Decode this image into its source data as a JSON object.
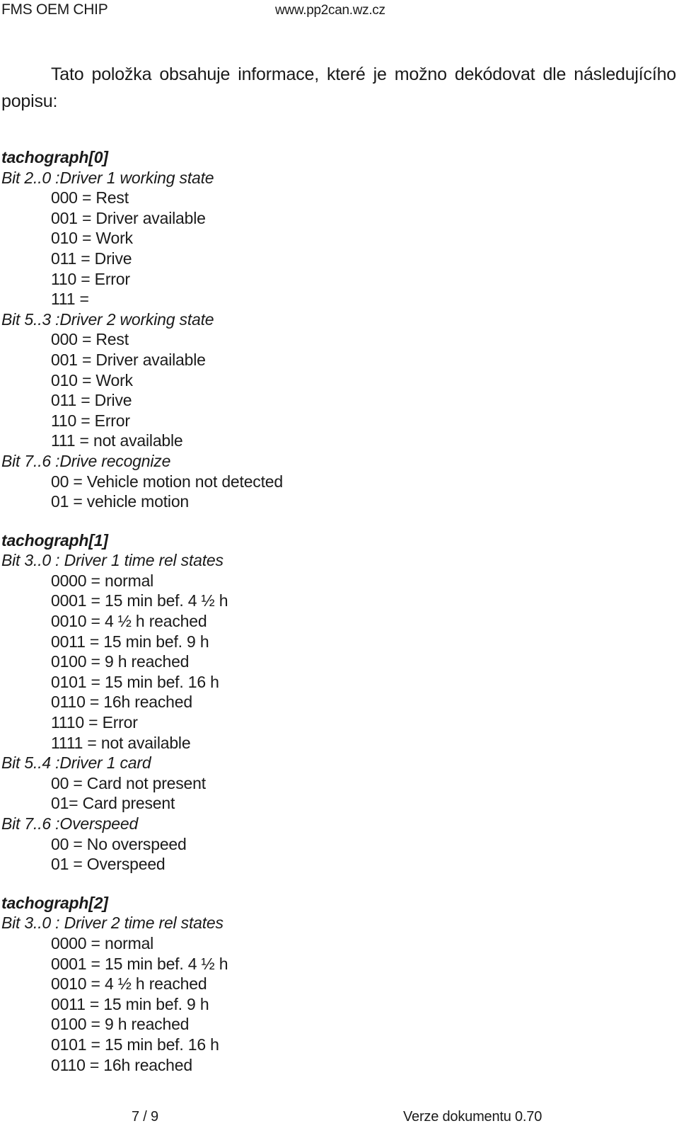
{
  "header": {
    "left": "FMS OEM CHIP",
    "right": "www.pp2can.wz.cz"
  },
  "intro": "Tato položka obsahuje informace, které je možno dekódovat dle následujícího popisu:",
  "sections": [
    {
      "title": "tachograph[0]",
      "groups": [
        {
          "bit": "Bit  2..0 :Driver 1 working state",
          "values": [
            "000 = Rest",
            "001 = Driver available",
            "010 = Work",
            "011 = Drive",
            "110 = Error",
            "111 = "
          ]
        },
        {
          "bit": "Bit  5..3 :Driver 2 working state",
          "values": [
            "000 = Rest",
            "001 = Driver available",
            "010 = Work",
            "011 = Drive",
            "110 = Error",
            "111 = not available"
          ]
        },
        {
          "bit": "Bit  7..6 :Drive recognize",
          "values": [
            "00 = Vehicle motion not detected",
            "01 = vehicle motion"
          ]
        }
      ]
    },
    {
      "title": "tachograph[1]",
      "groups": [
        {
          "bit": "Bit  3..0 : Driver 1 time rel states",
          "values": [
            "0000 = normal",
            "0001 = 15 min bef. 4 ½ h",
            "0010 = 4 ½ h reached",
            "0011 = 15 min bef. 9 h",
            "0100 = 9 h reached",
            "0101 = 15 min bef. 16 h",
            "0110 = 16h reached",
            "1110 = Error",
            "1111 = not available"
          ]
        },
        {
          "bit": "Bit  5..4 :Driver 1 card",
          "values": [
            "00 = Card not present",
            "01= Card present"
          ]
        },
        {
          "bit": "Bit  7..6 :Overspeed",
          "values": [
            "00 = No overspeed",
            "01 = Overspeed"
          ]
        }
      ]
    },
    {
      "title": "tachograph[2]",
      "groups": [
        {
          "bit": "Bit  3..0 : Driver 2 time rel states",
          "values": [
            "0000 = normal",
            "0001 = 15 min bef. 4 ½ h",
            "0010 = 4 ½ h reached",
            "0011 = 15 min bef. 9 h",
            "0100 = 9 h reached",
            "0101 = 15 min bef. 16 h",
            "0110 = 16h reached"
          ]
        }
      ]
    }
  ],
  "footer": {
    "page": "7 / 9",
    "version": "Verze dokumentu 0.70"
  }
}
